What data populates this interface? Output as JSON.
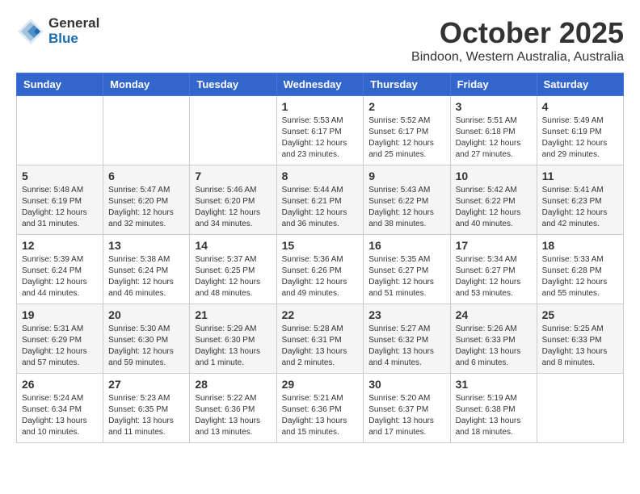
{
  "header": {
    "logo_general": "General",
    "logo_blue": "Blue",
    "month_title": "October 2025",
    "location": "Bindoon, Western Australia, Australia"
  },
  "weekdays": [
    "Sunday",
    "Monday",
    "Tuesday",
    "Wednesday",
    "Thursday",
    "Friday",
    "Saturday"
  ],
  "weeks": [
    [
      {
        "day": "",
        "info": ""
      },
      {
        "day": "",
        "info": ""
      },
      {
        "day": "",
        "info": ""
      },
      {
        "day": "1",
        "info": "Sunrise: 5:53 AM\nSunset: 6:17 PM\nDaylight: 12 hours\nand 23 minutes."
      },
      {
        "day": "2",
        "info": "Sunrise: 5:52 AM\nSunset: 6:17 PM\nDaylight: 12 hours\nand 25 minutes."
      },
      {
        "day": "3",
        "info": "Sunrise: 5:51 AM\nSunset: 6:18 PM\nDaylight: 12 hours\nand 27 minutes."
      },
      {
        "day": "4",
        "info": "Sunrise: 5:49 AM\nSunset: 6:19 PM\nDaylight: 12 hours\nand 29 minutes."
      }
    ],
    [
      {
        "day": "5",
        "info": "Sunrise: 5:48 AM\nSunset: 6:19 PM\nDaylight: 12 hours\nand 31 minutes."
      },
      {
        "day": "6",
        "info": "Sunrise: 5:47 AM\nSunset: 6:20 PM\nDaylight: 12 hours\nand 32 minutes."
      },
      {
        "day": "7",
        "info": "Sunrise: 5:46 AM\nSunset: 6:20 PM\nDaylight: 12 hours\nand 34 minutes."
      },
      {
        "day": "8",
        "info": "Sunrise: 5:44 AM\nSunset: 6:21 PM\nDaylight: 12 hours\nand 36 minutes."
      },
      {
        "day": "9",
        "info": "Sunrise: 5:43 AM\nSunset: 6:22 PM\nDaylight: 12 hours\nand 38 minutes."
      },
      {
        "day": "10",
        "info": "Sunrise: 5:42 AM\nSunset: 6:22 PM\nDaylight: 12 hours\nand 40 minutes."
      },
      {
        "day": "11",
        "info": "Sunrise: 5:41 AM\nSunset: 6:23 PM\nDaylight: 12 hours\nand 42 minutes."
      }
    ],
    [
      {
        "day": "12",
        "info": "Sunrise: 5:39 AM\nSunset: 6:24 PM\nDaylight: 12 hours\nand 44 minutes."
      },
      {
        "day": "13",
        "info": "Sunrise: 5:38 AM\nSunset: 6:24 PM\nDaylight: 12 hours\nand 46 minutes."
      },
      {
        "day": "14",
        "info": "Sunrise: 5:37 AM\nSunset: 6:25 PM\nDaylight: 12 hours\nand 48 minutes."
      },
      {
        "day": "15",
        "info": "Sunrise: 5:36 AM\nSunset: 6:26 PM\nDaylight: 12 hours\nand 49 minutes."
      },
      {
        "day": "16",
        "info": "Sunrise: 5:35 AM\nSunset: 6:27 PM\nDaylight: 12 hours\nand 51 minutes."
      },
      {
        "day": "17",
        "info": "Sunrise: 5:34 AM\nSunset: 6:27 PM\nDaylight: 12 hours\nand 53 minutes."
      },
      {
        "day": "18",
        "info": "Sunrise: 5:33 AM\nSunset: 6:28 PM\nDaylight: 12 hours\nand 55 minutes."
      }
    ],
    [
      {
        "day": "19",
        "info": "Sunrise: 5:31 AM\nSunset: 6:29 PM\nDaylight: 12 hours\nand 57 minutes."
      },
      {
        "day": "20",
        "info": "Sunrise: 5:30 AM\nSunset: 6:30 PM\nDaylight: 12 hours\nand 59 minutes."
      },
      {
        "day": "21",
        "info": "Sunrise: 5:29 AM\nSunset: 6:30 PM\nDaylight: 13 hours\nand 1 minute."
      },
      {
        "day": "22",
        "info": "Sunrise: 5:28 AM\nSunset: 6:31 PM\nDaylight: 13 hours\nand 2 minutes."
      },
      {
        "day": "23",
        "info": "Sunrise: 5:27 AM\nSunset: 6:32 PM\nDaylight: 13 hours\nand 4 minutes."
      },
      {
        "day": "24",
        "info": "Sunrise: 5:26 AM\nSunset: 6:33 PM\nDaylight: 13 hours\nand 6 minutes."
      },
      {
        "day": "25",
        "info": "Sunrise: 5:25 AM\nSunset: 6:33 PM\nDaylight: 13 hours\nand 8 minutes."
      }
    ],
    [
      {
        "day": "26",
        "info": "Sunrise: 5:24 AM\nSunset: 6:34 PM\nDaylight: 13 hours\nand 10 minutes."
      },
      {
        "day": "27",
        "info": "Sunrise: 5:23 AM\nSunset: 6:35 PM\nDaylight: 13 hours\nand 11 minutes."
      },
      {
        "day": "28",
        "info": "Sunrise: 5:22 AM\nSunset: 6:36 PM\nDaylight: 13 hours\nand 13 minutes."
      },
      {
        "day": "29",
        "info": "Sunrise: 5:21 AM\nSunset: 6:36 PM\nDaylight: 13 hours\nand 15 minutes."
      },
      {
        "day": "30",
        "info": "Sunrise: 5:20 AM\nSunset: 6:37 PM\nDaylight: 13 hours\nand 17 minutes."
      },
      {
        "day": "31",
        "info": "Sunrise: 5:19 AM\nSunset: 6:38 PM\nDaylight: 13 hours\nand 18 minutes."
      },
      {
        "day": "",
        "info": ""
      }
    ]
  ]
}
